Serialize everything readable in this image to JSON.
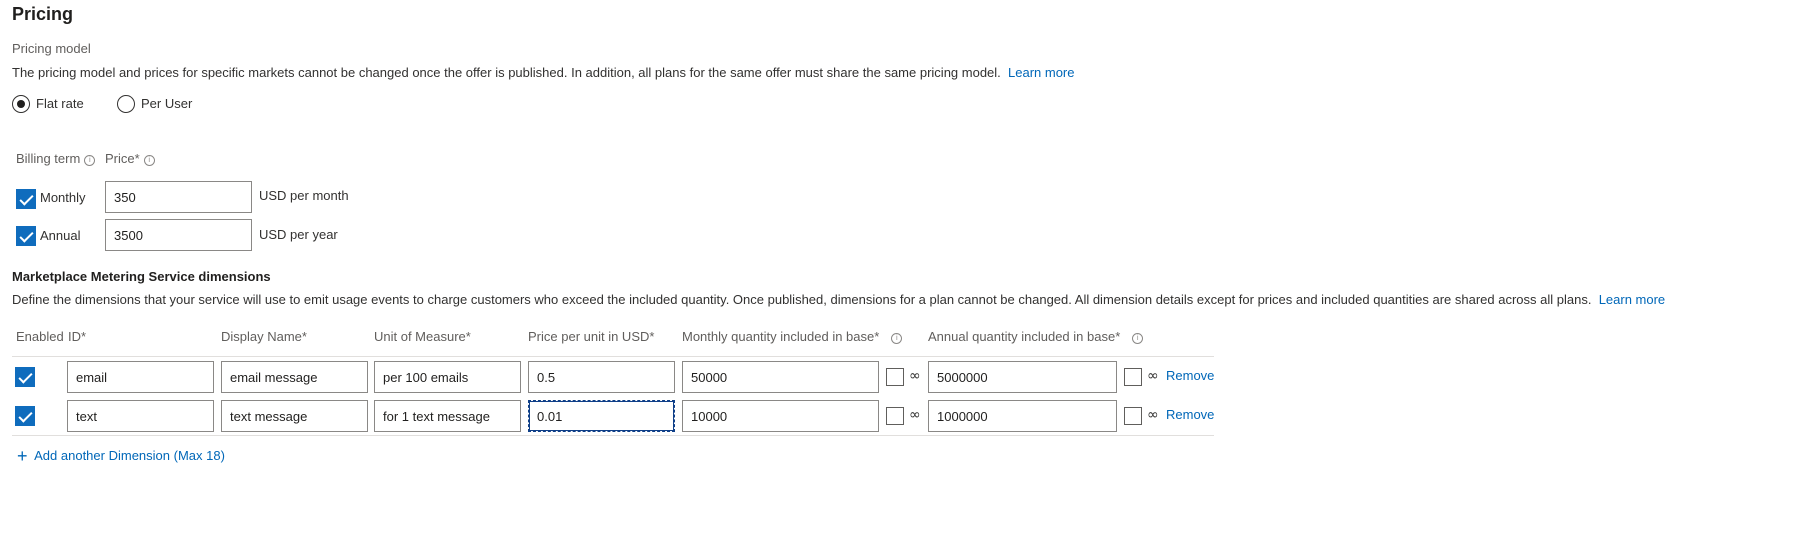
{
  "section": {
    "title": "Pricing",
    "model_label": "Pricing model",
    "model_description": "The pricing model and prices for specific markets cannot be changed once the offer is published. In addition, all plans for the same offer must share the same pricing model.",
    "learn_more": "Learn more"
  },
  "pricing_model": {
    "options": [
      {
        "label": "Flat rate",
        "selected": true
      },
      {
        "label": "Per User",
        "selected": false
      }
    ]
  },
  "billing": {
    "term_header": "Billing term",
    "price_header": "Price",
    "required_mark": "*",
    "rows": [
      {
        "term": "Monthly",
        "checked": true,
        "price": "350",
        "unit": "USD per month"
      },
      {
        "term": "Annual",
        "checked": true,
        "price": "3500",
        "unit": "USD per year"
      }
    ]
  },
  "metering": {
    "title": "Marketplace Metering Service dimensions",
    "description": "Define the dimensions that your service will use to emit usage events to charge customers who exceed the included quantity. Once published, dimensions for a plan cannot be changed. All dimension details except for prices and included quantities are shared across all plans.",
    "learn_more": "Learn more",
    "columns": {
      "enabled": "Enabled",
      "id": "ID",
      "display_name": "Display Name",
      "unit": "Unit of Measure",
      "price": "Price per unit in USD",
      "monthly": "Monthly quantity included in base",
      "annual": "Annual quantity included in base",
      "required_mark": "*"
    },
    "infinity_symbol": "∞",
    "remove_label": "Remove",
    "rows": [
      {
        "enabled": true,
        "id": "email",
        "display_name": "email message",
        "unit": "per 100 emails",
        "price": "0.5",
        "monthly": "50000",
        "monthly_unlimited": false,
        "annual": "5000000",
        "annual_unlimited": false
      },
      {
        "enabled": true,
        "id": "text",
        "display_name": "text message",
        "unit": "for 1 text message",
        "price": "0.01",
        "monthly": "10000",
        "monthly_unlimited": false,
        "annual": "1000000",
        "annual_unlimited": false
      }
    ],
    "add_label": "Add another Dimension (Max 18)",
    "add_icon": "plus-icon"
  },
  "colors": {
    "accent": "#0f6cbd",
    "link": "#0067b8"
  }
}
